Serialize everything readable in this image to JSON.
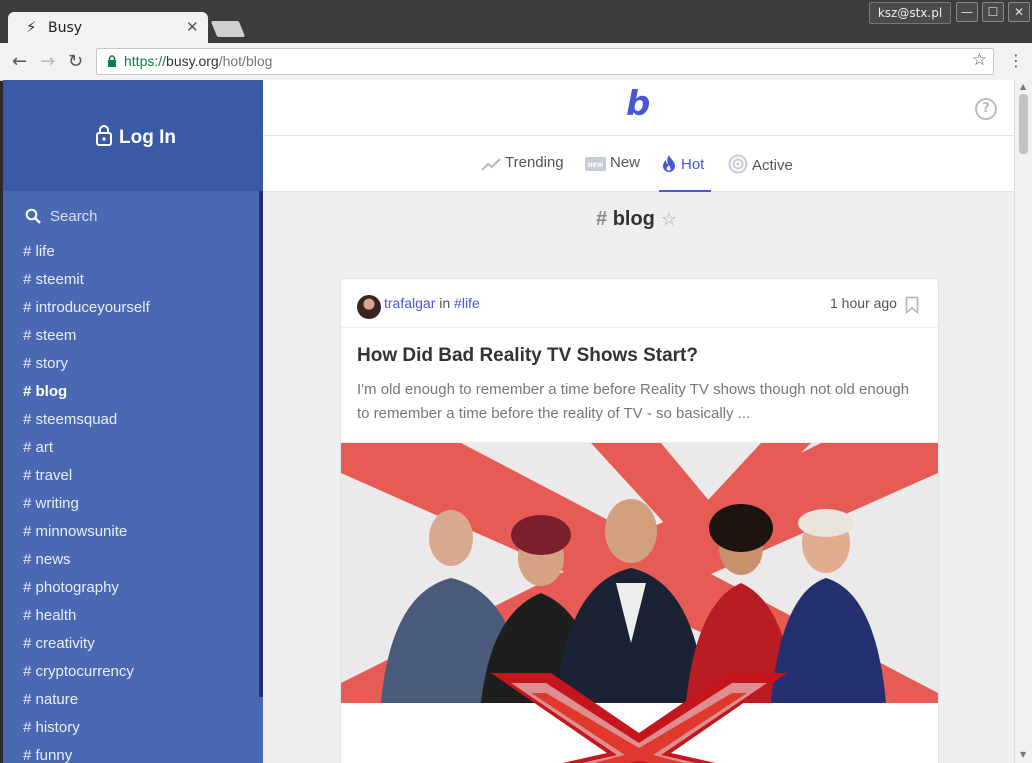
{
  "browser": {
    "tab_title": "Busy",
    "tab_close": "✕",
    "user": "ksz@stx.pl",
    "url_scheme": "https://",
    "url_host": "busy.org",
    "url_path": "/hot/blog"
  },
  "sidebar": {
    "login_label": "Log In",
    "search_placeholder": "Search",
    "tags": [
      "# life",
      "# steemit",
      "# introduceyourself",
      "# steem",
      "# story",
      "# blog",
      "# steemsquad",
      "# art",
      "# travel",
      "# writing",
      "# minnowsunite",
      "# news",
      "# photography",
      "# health",
      "# creativity",
      "# cryptocurrency",
      "# nature",
      "# history",
      "# funny"
    ],
    "active_tag": "# blog"
  },
  "header": {
    "logo": "b",
    "help": "?"
  },
  "nav": {
    "trending": "Trending",
    "new": "New",
    "new_badge": "NEW",
    "hot": "Hot",
    "active": "Active"
  },
  "page": {
    "hash": "#",
    "tag": "blog",
    "fav": "☆"
  },
  "post": {
    "author": "trafalgar",
    "in": "in",
    "category": "#life",
    "time": "1 hour ago",
    "title": "How Did Bad Reality TV Shows Start?",
    "excerpt": "I'm old enough to remember a time before Reality TV shows though not old enough to remember a time before the reality of TV - so basically ..."
  },
  "colors": {
    "sidebar": "#4b69b2",
    "login_bg": "#3a5aa6",
    "accent": "#4757d8"
  }
}
